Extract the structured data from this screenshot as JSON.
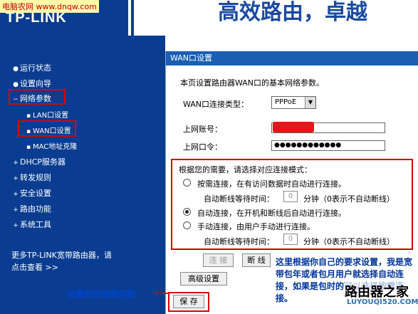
{
  "header": {
    "site_watermark": "电脑农网 www.dnqw.com",
    "logo": "TP-LINK",
    "slogan": "高效路由，卓越"
  },
  "sidebar": {
    "items": [
      {
        "label": "运行状态"
      },
      {
        "label": "设置向导"
      },
      {
        "label": "网络参数"
      },
      {
        "label": "LAN口设置"
      },
      {
        "label": "WAN口设置"
      },
      {
        "label": "MAC地址克隆"
      },
      {
        "label": "DHCP服务器"
      },
      {
        "label": "转发规则"
      },
      {
        "label": "安全设置"
      },
      {
        "label": "路由功能"
      },
      {
        "label": "系统工具"
      }
    ],
    "more_link": "更多TP-LINK宽带路由器，请点击查看 >>"
  },
  "panel": {
    "title": "WAN口设置",
    "description": "本页设置路由器WAN口的基本网络参数。",
    "conn_type_label": "WAN口连接类型：",
    "conn_type_value": "PPPoE",
    "account_label": "上网账号：",
    "password_label": "上网口令：",
    "password_mask": "●●●●●●●●●●●●",
    "mode_prompt": "根据您的需要，请选择对应连接模式：",
    "mode_on_demand": "按需连接，在有访问数据时自动进行连接。",
    "idle_label": "自动断线等待时间：",
    "idle_value": "0",
    "idle_unit": "分钟（0表示不自动断线）",
    "mode_auto": "自动连接，在开机和断线后自动进行连接。",
    "mode_manual": "手动连接，由用户手动进行连接。",
    "connect_btn": "连 接",
    "disconnect_btn": "断 线",
    "advanced_btn": "高级设置",
    "save_btn": "保 存"
  },
  "annotations": {
    "note": "这里根据你自己的要求设置，我是宽带包年或者包月用户就选择自动连接，如果是包时的可以选择按需连接。",
    "save_hint": "设置好后按保存即",
    "watermark_logo": "路由器之家",
    "watermark_url": "LUYOUQI520.COM"
  },
  "colors": {
    "header_blue": "#0a3d91",
    "title_blue": "#1a5fb4",
    "annotation_red": "#e00000"
  }
}
